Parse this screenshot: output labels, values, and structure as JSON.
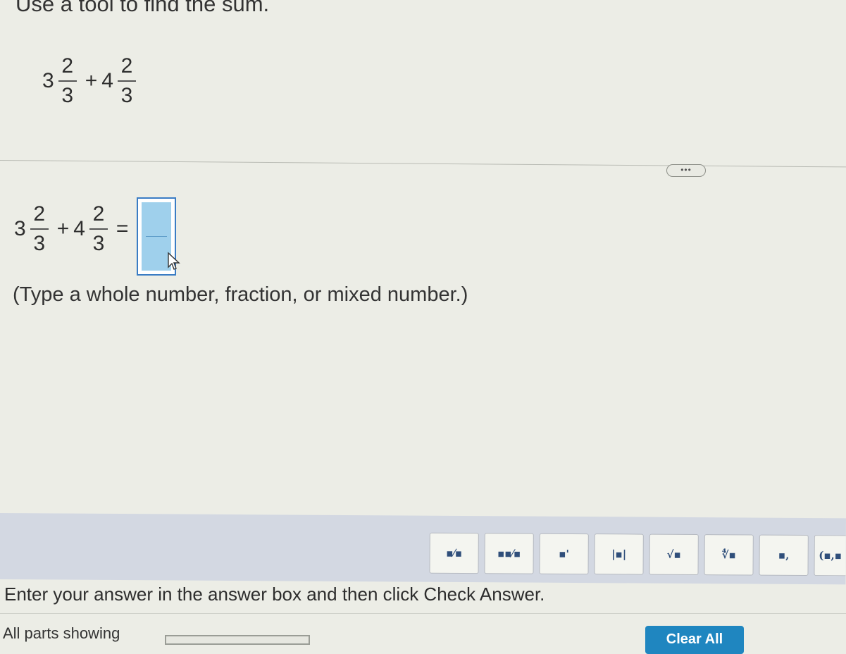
{
  "question": {
    "instruction": "Use a tool to find the sum.",
    "expression": {
      "term1": {
        "whole": "3",
        "numerator": "2",
        "denominator": "3"
      },
      "operator": "+",
      "term2": {
        "whole": "4",
        "numerator": "2",
        "denominator": "3"
      }
    }
  },
  "more_button": {
    "label": "•••"
  },
  "answer": {
    "expression": {
      "term1": {
        "whole": "3",
        "numerator": "2",
        "denominator": "3"
      },
      "operator": "+",
      "term2": {
        "whole": "4",
        "numerator": "2",
        "denominator": "3"
      },
      "equals": "="
    },
    "numerator_value": "",
    "denominator_value": "",
    "hint": "(Type a whole number, fraction, or mixed number.)"
  },
  "toolbar": {
    "buttons": [
      {
        "icon": "fraction-icon",
        "glyph": "▪⁄▪"
      },
      {
        "icon": "mixed-number-icon",
        "glyph": "▪▪⁄▪"
      },
      {
        "icon": "exponent-icon",
        "glyph": "▪'"
      },
      {
        "icon": "absolute-value-icon",
        "glyph": "|▪|"
      },
      {
        "icon": "square-root-icon",
        "glyph": "√▪"
      },
      {
        "icon": "nth-root-icon",
        "glyph": "∜▪"
      },
      {
        "icon": "subscript-icon",
        "glyph": "▪,"
      },
      {
        "icon": "ordered-pair-icon",
        "glyph": "(▪,▪"
      }
    ]
  },
  "footer": {
    "instruction": "Enter your answer in the answer box and then click Check Answer.",
    "parts_label": "All parts showing",
    "clear_all_label": "Clear All"
  }
}
